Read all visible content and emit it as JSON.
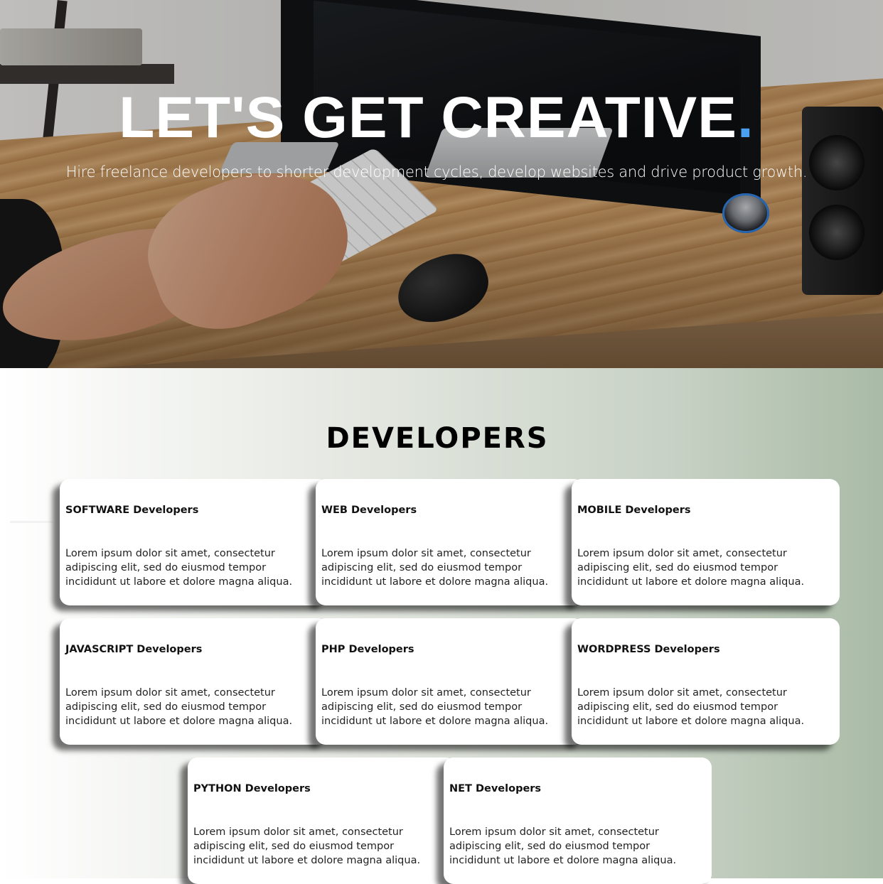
{
  "hero": {
    "title": "LET'S GET CREATIVE",
    "title_dot": ".",
    "subtitle": "Hire freelance developers to shorter development cycles, develop websites and drive product growth.",
    "image_alt": "desk-workspace-photo"
  },
  "developers": {
    "heading": "DEVELOPERS",
    "cards": [
      {
        "title": "SOFTWARE Developers",
        "text": "Lorem ipsum dolor sit amet, consectetur adipiscing elit, sed do eiusmod tempor incididunt ut labore et dolore magna aliqua."
      },
      {
        "title": "WEB Developers",
        "text": "Lorem ipsum dolor sit amet, consectetur adipiscing elit, sed do eiusmod tempor incididunt ut labore et dolore magna aliqua."
      },
      {
        "title": "MOBILE Developers",
        "text": "Lorem ipsum dolor sit amet, consectetur adipiscing elit, sed do eiusmod tempor incididunt ut labore et dolore magna aliqua."
      },
      {
        "title": "JAVASCRIPT Developers",
        "text": "Lorem ipsum dolor sit amet, consectetur adipiscing elit, sed do eiusmod tempor incididunt ut labore et dolore magna aliqua."
      },
      {
        "title": "PHP Developers",
        "text": "Lorem ipsum dolor sit amet, consectetur adipiscing elit, sed do eiusmod tempor incididunt ut labore et dolore magna aliqua."
      },
      {
        "title": "WORDPRESS Developers",
        "text": "Lorem ipsum dolor sit amet, consectetur adipiscing elit, sed do eiusmod tempor incididunt ut labore et dolore magna aliqua."
      },
      {
        "title": "PYTHON Developers",
        "text": "Lorem ipsum dolor sit amet, consectetur adipiscing elit, sed do eiusmod tempor incididunt ut labore et dolore magna aliqua."
      },
      {
        "title": "NET Developers",
        "text": "Lorem ipsum dolor sit amet, consectetur adipiscing elit, sed do eiusmod tempor incididunt ut labore et dolore magna aliqua."
      }
    ]
  },
  "colors": {
    "accent_dot": "#4aa0ee",
    "section_gradient_end": "#a9bba6",
    "card_bg": "#ffffff"
  }
}
